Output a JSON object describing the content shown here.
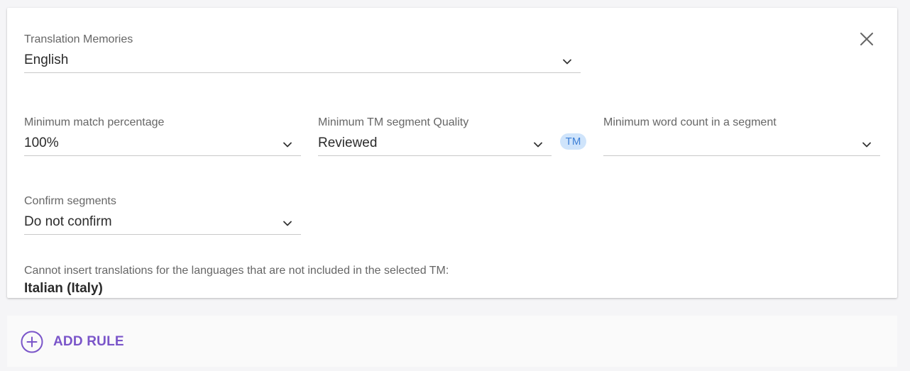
{
  "rule": {
    "close_icon": "close-icon",
    "translation_memories": {
      "label": "Translation Memories",
      "value": "English"
    },
    "min_match": {
      "label": "Minimum match percentage",
      "value": "100%"
    },
    "min_quality": {
      "label": "Minimum TM segment Quality",
      "value": "Reviewed"
    },
    "tm_badge": "TM",
    "min_word_count": {
      "label": "Minimum word count in a segment",
      "value": ""
    },
    "confirm_segments": {
      "label": "Confirm segments",
      "value": "Do not confirm"
    },
    "notice": "Cannot insert translations for the languages that are not included in the selected TM:",
    "notice_value": "Italian (Italy)"
  },
  "add_rule": {
    "label": "ADD RULE",
    "icon": "plus-circle-icon"
  },
  "colors": {
    "accent": "#7a55c9",
    "badge_bg": "#cfe4fb",
    "badge_text": "#3d7fd6"
  }
}
